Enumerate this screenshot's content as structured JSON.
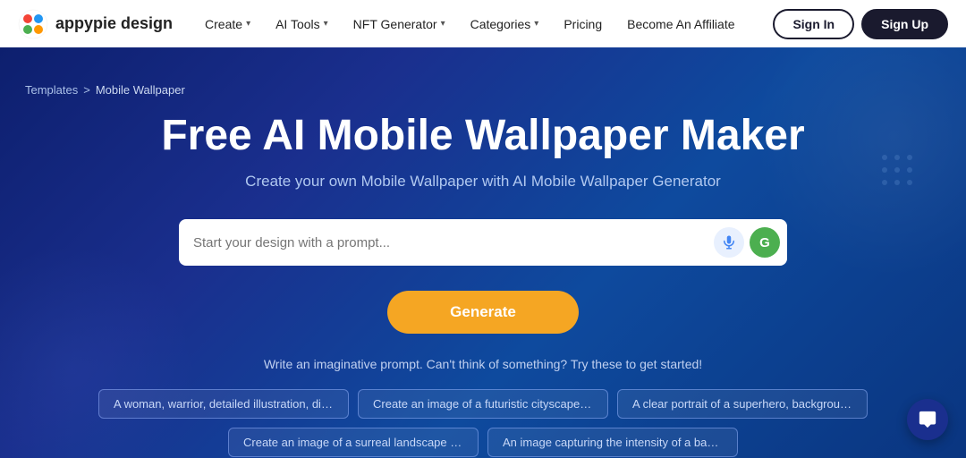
{
  "brand": {
    "name": "appypie design",
    "logo_alt": "Appypie Design Logo"
  },
  "navbar": {
    "items": [
      {
        "label": "Create",
        "has_dropdown": true
      },
      {
        "label": "AI Tools",
        "has_dropdown": true
      },
      {
        "label": "NFT Generator",
        "has_dropdown": true
      },
      {
        "label": "Categories",
        "has_dropdown": true
      },
      {
        "label": "Pricing",
        "has_dropdown": false
      },
      {
        "label": "Become An Affiliate",
        "has_dropdown": false
      }
    ],
    "signin_label": "Sign In",
    "signup_label": "Sign Up"
  },
  "breadcrumb": {
    "parent": "Templates",
    "separator": ">",
    "current": "Mobile Wallpaper"
  },
  "hero": {
    "title": "Free AI Mobile Wallpaper Maker",
    "subtitle": "Create your own Mobile Wallpaper with AI Mobile Wallpaper Generator",
    "search_placeholder": "Start your design with a prompt...",
    "generate_label": "Generate",
    "prompt_hint": "Write an imaginative prompt. Can't think of something? Try these to get started!",
    "prompt_tags": [
      "A woman, warrior, detailed illustration, digital art,...",
      "Create an image of a futuristic cityscape with to...",
      "A clear portrait of a superhero, background hype...",
      "Create an image of a surreal landscape with flo...",
      "An image capturing the intensity of a basketball ..."
    ]
  }
}
